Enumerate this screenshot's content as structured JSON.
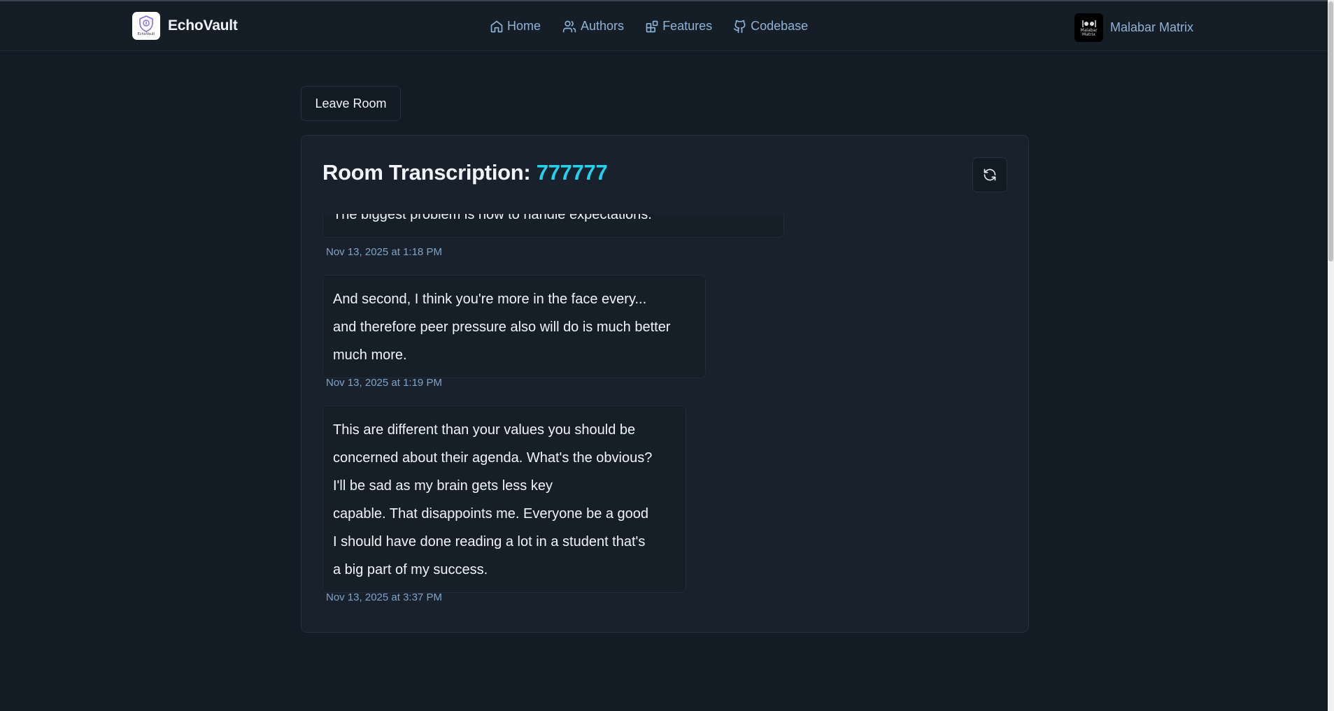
{
  "header": {
    "brand_name": "EchoVault",
    "brand_logo_text": "EchoVault",
    "nav": [
      {
        "label": "Home",
        "icon": "home-icon"
      },
      {
        "label": "Authors",
        "icon": "users-icon"
      },
      {
        "label": "Features",
        "icon": "blocks-icon"
      },
      {
        "label": "Codebase",
        "icon": "github-icon"
      }
    ],
    "user": {
      "name": "Malabar Matrix",
      "avatar_text_1": "Malabar",
      "avatar_text_2": "Matrix"
    }
  },
  "actions": {
    "leave_label": "Leave Room"
  },
  "transcription": {
    "title": "Room Transcription:",
    "room_id": "777777",
    "messages": [
      {
        "lines": [
          "The biggest problem is how to handle expectations."
        ],
        "time": "Nov 13, 2025 at 1:18 PM"
      },
      {
        "lines": [
          "And second, I think you're more in the face every...",
          "and therefore peer pressure also will do is much better",
          "much more."
        ],
        "time": "Nov 13, 2025 at 1:19 PM"
      },
      {
        "lines": [
          "This are different than your values you should be",
          "concerned about their agenda. What's the obvious?",
          "I'll be sad as my brain gets less key",
          "capable. That disappoints me. Everyone be a good",
          "I should have done reading a lot in a student that's",
          "a big part of my success."
        ],
        "time": "Nov 13, 2025 at 3:37 PM"
      }
    ]
  },
  "colors": {
    "background": "#131b25",
    "accent": "#22d3ee",
    "nav_text": "#8fb3d6",
    "timestamp": "#7fa4cc"
  }
}
